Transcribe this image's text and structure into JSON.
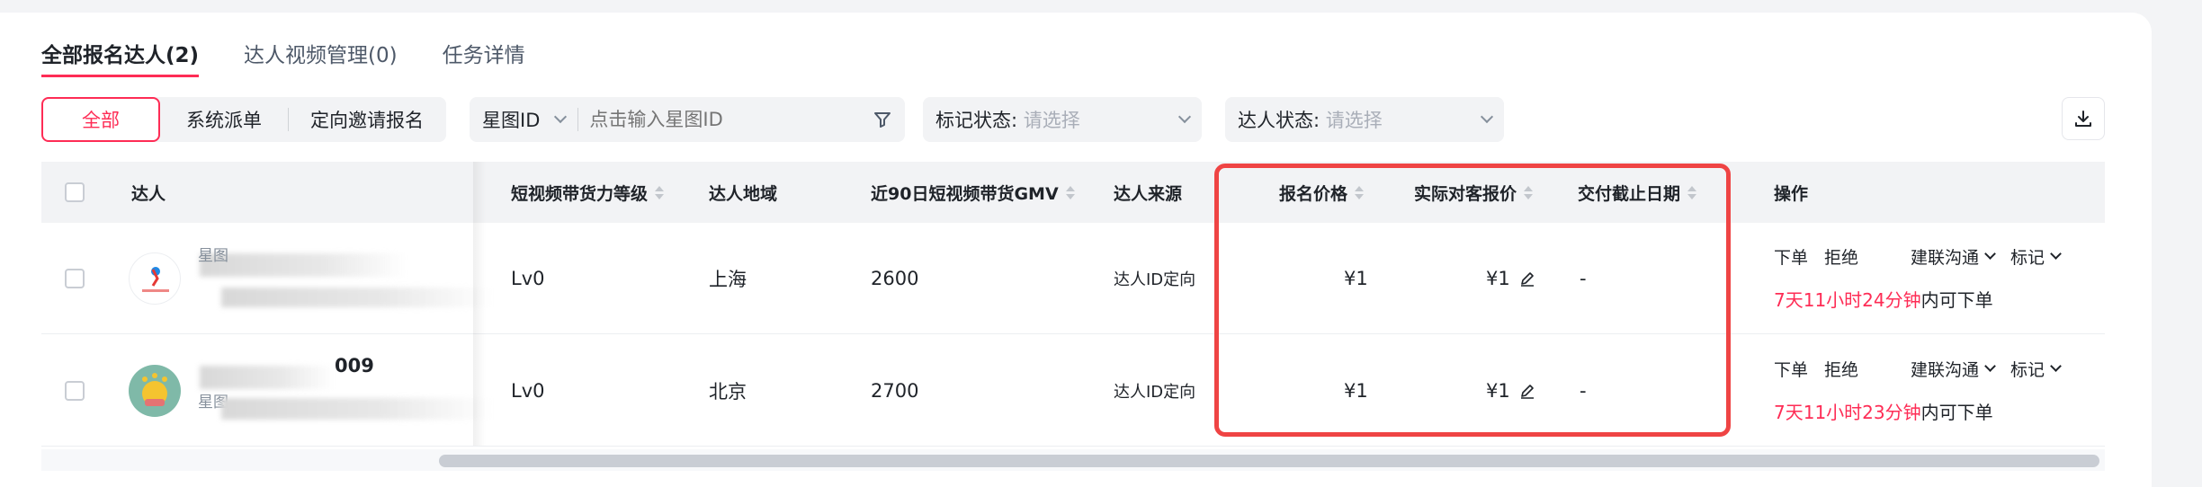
{
  "tabs": [
    {
      "label": "全部报名达人(2)",
      "active": true
    },
    {
      "label": "达人视频管理(0)",
      "active": false
    },
    {
      "label": "任务详情",
      "active": false
    }
  ],
  "segments": [
    {
      "label": "全部",
      "active": true
    },
    {
      "label": "系统派单",
      "active": false
    },
    {
      "label": "定向邀请报名",
      "active": false
    }
  ],
  "filters": {
    "id_type": "星图ID",
    "id_placeholder": "点击输入星图ID",
    "mark_label": "标记状态:",
    "mark_placeholder": "请选择",
    "status_label": "达人状态:",
    "status_placeholder": "请选择"
  },
  "columns": {
    "creator": "达人",
    "level": "短视频带货力等级",
    "region": "达人地域",
    "gmv": "近90日短视频带货GMV",
    "source": "达人来源",
    "signup_price": "报名价格",
    "actual_price": "实际对客报价",
    "deadline": "交付截止日期",
    "actions": "操作"
  },
  "rows": [
    {
      "name_suffix": "",
      "id_prefix": "星图",
      "level": "Lv0",
      "region": "上海",
      "gmv": "2600",
      "source": "达人ID定向",
      "signup_price": "¥1",
      "actual_price": "¥1",
      "deadline": "-",
      "action_order": "下单",
      "action_reject": "拒绝",
      "action_contact": "建联沟通",
      "action_mark": "标记",
      "countdown": "7天11小时24分钟",
      "countdown_suffix": "内可下单"
    },
    {
      "name_suffix": "009",
      "id_prefix": "星图",
      "level": "Lv0",
      "region": "北京",
      "gmv": "2700",
      "source": "达人ID定向",
      "signup_price": "¥1",
      "actual_price": "¥1",
      "deadline": "-",
      "action_order": "下单",
      "action_reject": "拒绝",
      "action_contact": "建联沟通",
      "action_mark": "标记",
      "countdown": "7天11小时23分钟",
      "countdown_suffix": "内可下单"
    }
  ],
  "colors": {
    "accent": "#fe2c55",
    "highlight": "#ef4444"
  }
}
